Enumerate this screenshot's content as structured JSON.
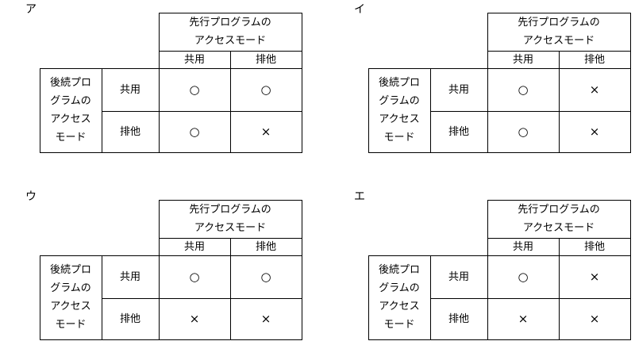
{
  "headers": {
    "prior_line1": "先行プログラムの",
    "prior_line2": "アクセスモード",
    "shared": "共用",
    "exclusive": "排他",
    "subsequent_lines": [
      "後続プロ",
      "グラムの",
      "アクセス",
      "モード"
    ]
  },
  "options": [
    {
      "label": "ア",
      "cells": {
        "shared_shared": "○",
        "shared_exclusive": "○",
        "exclusive_shared": "○",
        "exclusive_exclusive": "×"
      }
    },
    {
      "label": "イ",
      "cells": {
        "shared_shared": "○",
        "shared_exclusive": "×",
        "exclusive_shared": "○",
        "exclusive_exclusive": "×"
      }
    },
    {
      "label": "ウ",
      "cells": {
        "shared_shared": "○",
        "shared_exclusive": "○",
        "exclusive_shared": "×",
        "exclusive_exclusive": "×"
      }
    },
    {
      "label": "エ",
      "cells": {
        "shared_shared": "○",
        "shared_exclusive": "×",
        "exclusive_shared": "×",
        "exclusive_exclusive": "×"
      }
    }
  ]
}
